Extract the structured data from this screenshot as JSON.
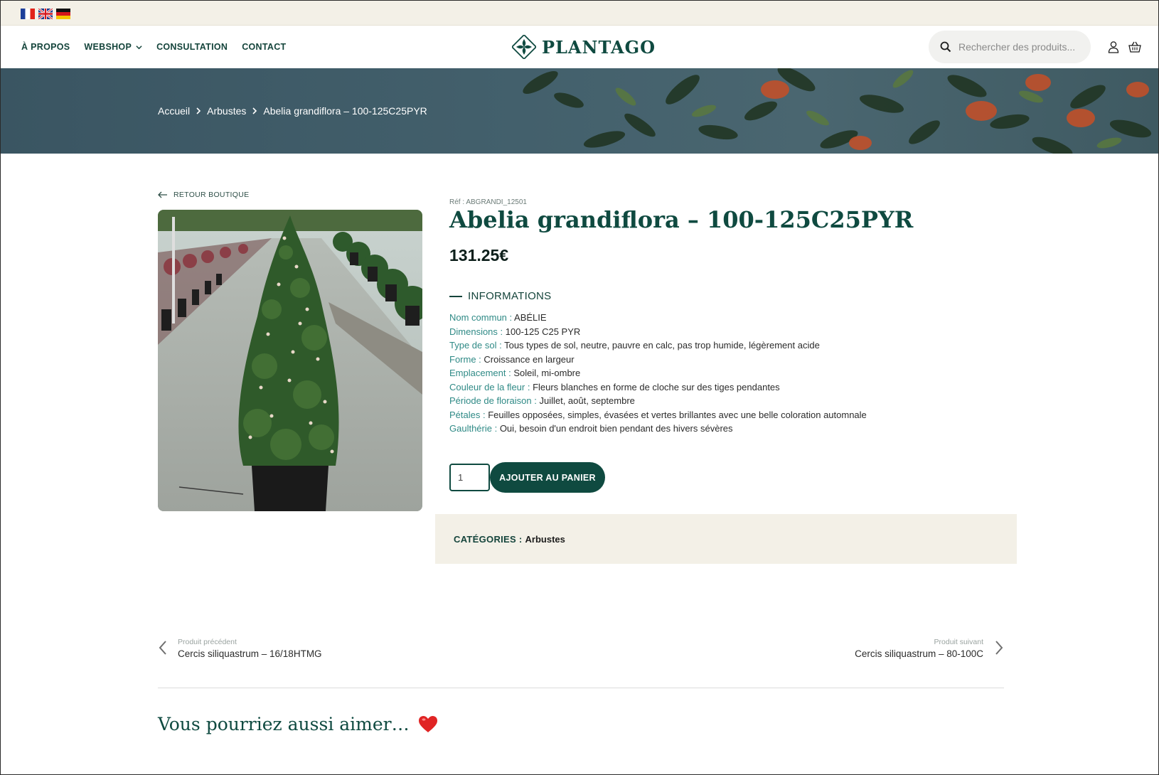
{
  "languages": [
    {
      "name": "fr-flag-icon",
      "label": "Français"
    },
    {
      "name": "uk-flag-icon",
      "label": "English"
    },
    {
      "name": "de-flag-icon",
      "label": "Deutsch"
    }
  ],
  "header": {
    "nav": [
      "À PROPOS",
      "WEBSHOP",
      "CONSULTATION",
      "CONTACT"
    ],
    "logo_text": "PLANTAGO",
    "search_placeholder": "Rechercher des produits...",
    "icons": [
      "search-icon",
      "user-icon",
      "basket-icon",
      "chevron-down-icon"
    ]
  },
  "breadcrumb": [
    "Accueil",
    "Arbustes",
    "Abelia grandiflora – 100-125C25PYR"
  ],
  "product": {
    "back_label": "RETOUR BOUTIQUE",
    "ref": "Réf : ABGRANDI_12501",
    "title": "Abelia grandiflora – 100-125C25PYR",
    "price": "131.25€",
    "info_heading": "INFORMATIONS",
    "info": [
      {
        "key": "Nom commun :",
        "value": " ABÉLIE"
      },
      {
        "key": "Dimensions :",
        "value": " 100-125 C25 PYR"
      },
      {
        "key": "Type de sol :",
        "value": " Tous types de sol, neutre, pauvre en calc, pas trop humide, légèrement acide"
      },
      {
        "key": "Forme :",
        "value": " Croissance en largeur"
      },
      {
        "key": "Emplacement :",
        "value": " Soleil, mi-ombre"
      },
      {
        "key": "Couleur de la fleur :",
        "value": " Fleurs blanches en forme de cloche sur des tiges pendantes"
      },
      {
        "key": "Période de floraison :",
        "value": " Juillet, août, septembre"
      },
      {
        "key": "Pétales :",
        "value": " Feuilles opposées, simples, évasées et vertes brillantes avec une belle coloration automnale"
      },
      {
        "key": "Gaulthérie :",
        "value": " Oui, besoin d'un endroit bien pendant des hivers sévères"
      }
    ],
    "quantity": "1",
    "add_to_cart": "AJOUTER AU PANIER",
    "categories_label": "CATÉGORIES :",
    "categories_value": "Arbustes"
  },
  "navigation": {
    "prev_label": "Produit précédent",
    "prev_title": "Cercis siliquastrum – 16/18HTMG",
    "next_label": "Produit suivant",
    "next_title": "Cercis siliquastrum – 80-100C"
  },
  "related_heading": "Vous pourriez aussi aimer…",
  "colors": {
    "brand": "#0f4a40",
    "accent_teal": "#2f8a86",
    "cream": "#f3f0e7"
  }
}
